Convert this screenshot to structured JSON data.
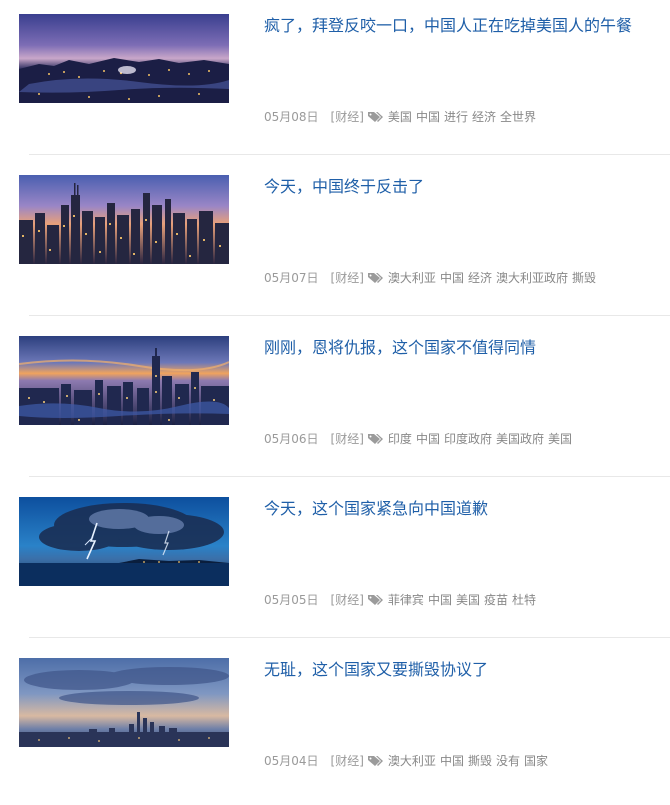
{
  "articles": [
    {
      "title": "疯了，拜登反咬一口，中国人正在吃掉美国人的午餐",
      "date": "05月08日",
      "category": "[财经]",
      "tags": [
        "美国",
        "中国",
        "进行",
        "经济",
        "全世界"
      ]
    },
    {
      "title": "今天，中国终于反击了",
      "date": "05月07日",
      "category": "[财经]",
      "tags": [
        "澳大利亚",
        "中国",
        "经济",
        "澳大利亚政府",
        "撕毁"
      ]
    },
    {
      "title": "刚刚，恩将仇报，这个国家不值得同情",
      "date": "05月06日",
      "category": "[财经]",
      "tags": [
        "印度",
        "中国",
        "印度政府",
        "美国政府",
        "美国"
      ]
    },
    {
      "title": "今天，这个国家紧急向中国道歉",
      "date": "05月05日",
      "category": "[财经]",
      "tags": [
        "菲律宾",
        "中国",
        "美国",
        "疫苗",
        "杜特"
      ]
    },
    {
      "title": "无耻，这个国家又要撕毁协议了",
      "date": "05月04日",
      "category": "[财经]",
      "tags": [
        "澳大利亚",
        "中国",
        "撕毁",
        "没有",
        "国家"
      ]
    }
  ],
  "icons": {
    "tag": "tags-icon"
  },
  "colors": {
    "title": "#1f5fa8",
    "meta": "#999999",
    "divider": "#e8e8e8"
  }
}
